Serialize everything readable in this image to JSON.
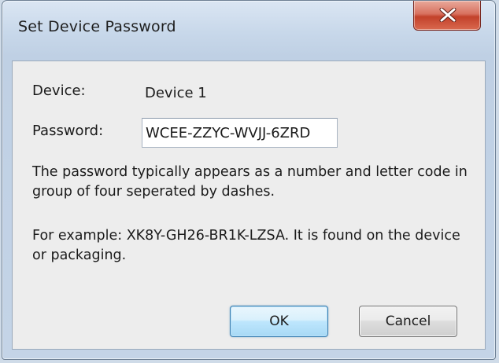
{
  "window": {
    "title": "Set Device Password"
  },
  "titlebar": {
    "close_icon": "close-x-icon",
    "close_color": "#c2412a"
  },
  "form": {
    "device_label": "Device:",
    "device_value": "Device 1",
    "password_label": "Password:",
    "password_value": "WCEE-ZZYC-WVJJ-6ZRD"
  },
  "help": {
    "line1": "The password typically appears as a number and letter code in group of four seperated by dashes.",
    "line2": "For example: XK8Y-GH26-BR1K-LZSA. It is found on the device or packaging."
  },
  "buttons": {
    "ok_label": "OK",
    "cancel_label": "Cancel"
  }
}
